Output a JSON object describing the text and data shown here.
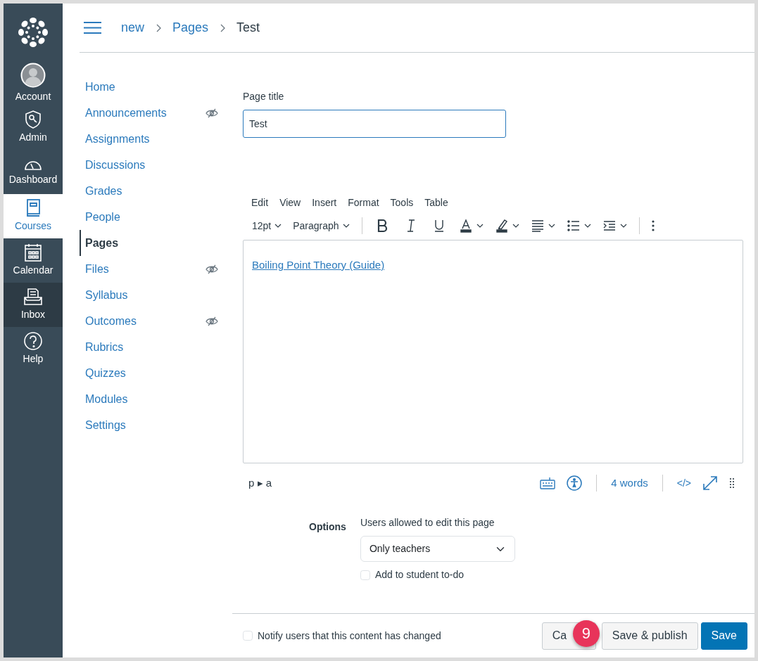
{
  "global_nav": {
    "items": [
      {
        "label": "Account",
        "selected": false,
        "hovered": false
      },
      {
        "label": "Admin",
        "selected": false,
        "hovered": false
      },
      {
        "label": "Dashboard",
        "selected": false,
        "hovered": false
      },
      {
        "label": "Courses",
        "selected": true,
        "hovered": false
      },
      {
        "label": "Calendar",
        "selected": false,
        "hovered": false
      },
      {
        "label": "Inbox",
        "selected": false,
        "hovered": true
      },
      {
        "label": "Help",
        "selected": false,
        "hovered": false
      }
    ]
  },
  "breadcrumb": [
    {
      "label": "new",
      "current": false
    },
    {
      "label": "Pages",
      "current": false
    },
    {
      "label": "Test",
      "current": true
    }
  ],
  "course_nav": {
    "items": [
      {
        "label": "Home",
        "selected": false,
        "hidden": false
      },
      {
        "label": "Announcements",
        "selected": false,
        "hidden": true
      },
      {
        "label": "Assignments",
        "selected": false,
        "hidden": false
      },
      {
        "label": "Discussions",
        "selected": false,
        "hidden": false
      },
      {
        "label": "Grades",
        "selected": false,
        "hidden": false
      },
      {
        "label": "People",
        "selected": false,
        "hidden": false
      },
      {
        "label": "Pages",
        "selected": true,
        "hidden": false
      },
      {
        "label": "Files",
        "selected": false,
        "hidden": true
      },
      {
        "label": "Syllabus",
        "selected": false,
        "hidden": false
      },
      {
        "label": "Outcomes",
        "selected": false,
        "hidden": true
      },
      {
        "label": "Rubrics",
        "selected": false,
        "hidden": false
      },
      {
        "label": "Quizzes",
        "selected": false,
        "hidden": false
      },
      {
        "label": "Modules",
        "selected": false,
        "hidden": false
      },
      {
        "label": "Settings",
        "selected": false,
        "hidden": false
      }
    ]
  },
  "page_title": {
    "label": "Page title",
    "value": "Test"
  },
  "editor": {
    "menu": [
      "Edit",
      "View",
      "Insert",
      "Format",
      "Tools",
      "Table"
    ],
    "font_size": "12pt",
    "block_format": "Paragraph",
    "content_link": "Boiling Point Theory (Guide)",
    "element_path": "p ▸ a",
    "word_count": "4 words",
    "code_view": "</>"
  },
  "options": {
    "label": "Options",
    "editors_label": "Users allowed to edit this page",
    "editors_value": "Only teachers",
    "todo": {
      "label": "Add to student to-do",
      "checked": false
    }
  },
  "footer": {
    "notify": {
      "label": "Notify users that this content has changed",
      "checked": false
    },
    "buttons": [
      {
        "label": "Ca",
        "kind": "secondary"
      },
      {
        "label": "Save & publish",
        "kind": "secondary"
      },
      {
        "label": "Save",
        "kind": "primary"
      }
    ],
    "step_badge": "9"
  }
}
